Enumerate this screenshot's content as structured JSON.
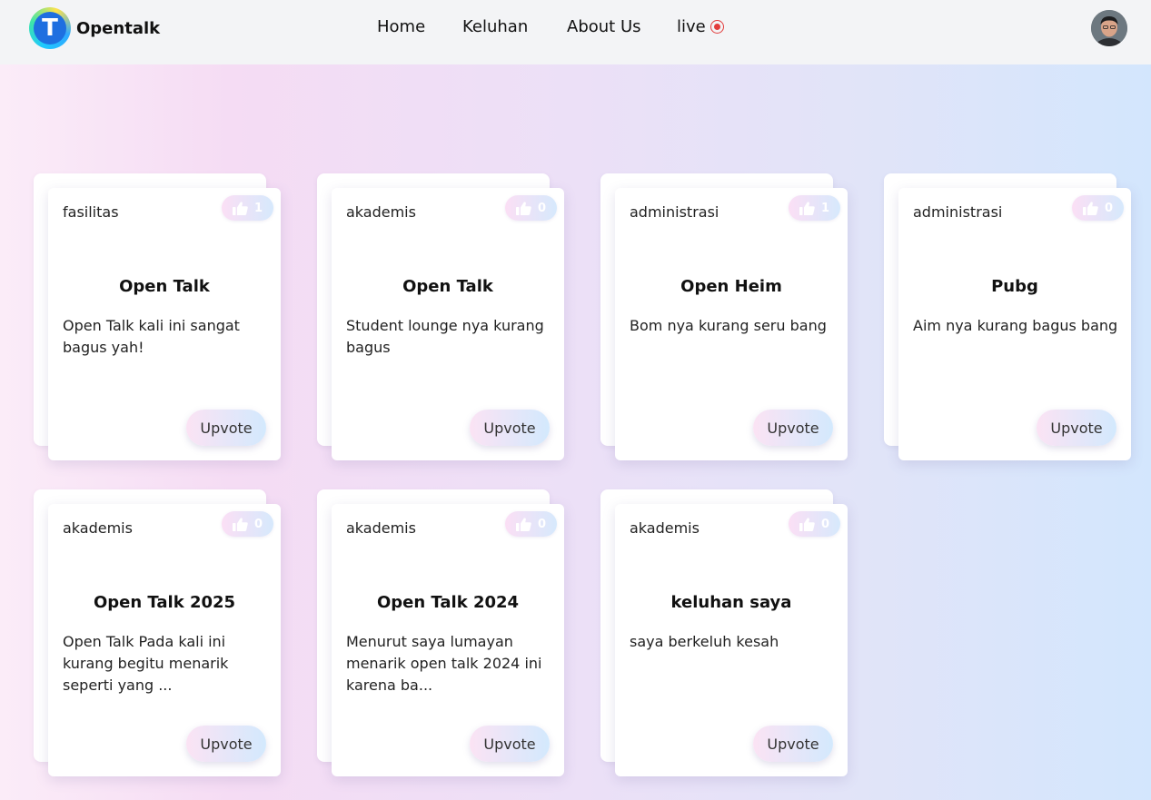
{
  "navbar": {
    "brand": "Opentalk",
    "logo_letter": "T",
    "links": {
      "home": "Home",
      "keluhan": "Keluhan",
      "about": "About Us",
      "live": "live"
    }
  },
  "upvote_label": "Upvote",
  "cards": [
    {
      "category": "fasilitas",
      "likes": "1",
      "title": "Open Talk",
      "description": "Open Talk kali ini sangat bagus yah!"
    },
    {
      "category": "akademis",
      "likes": "0",
      "title": "Open Talk",
      "description": "Student lounge nya kurang bagus"
    },
    {
      "category": "administrasi",
      "likes": "1",
      "title": "Open Heim",
      "description": "Bom nya kurang seru bang"
    },
    {
      "category": "administrasi",
      "likes": "0",
      "title": "Pubg",
      "description": "Aim nya kurang bagus bang"
    },
    {
      "category": "akademis",
      "likes": "0",
      "title": "Open Talk 2025",
      "description": "Open Talk Pada kali ini kurang begitu menarik seperti yang ..."
    },
    {
      "category": "akademis",
      "likes": "0",
      "title": "Open Talk 2024",
      "description": "Menurut saya lumayan menarik open talk 2024 ini karena ba..."
    },
    {
      "category": "akademis",
      "likes": "0",
      "title": "keluhan saya",
      "description": "saya berkeluh kesah"
    }
  ],
  "colors": {
    "navbar_bg": "#f3f4f6",
    "live_red": "#e23b3b",
    "accent_pink": "#fbe3f4",
    "accent_blue": "#d3e9fd"
  }
}
